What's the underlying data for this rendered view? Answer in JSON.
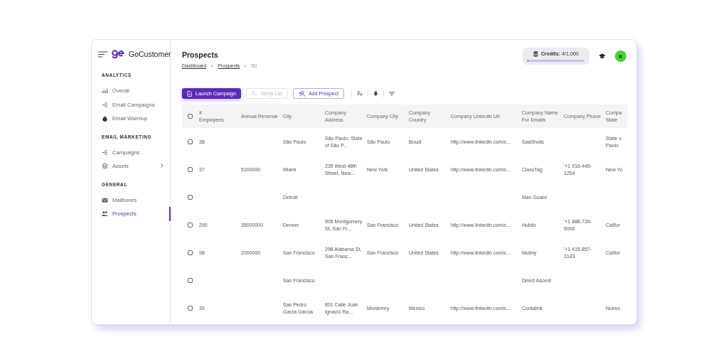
{
  "sidebar": {
    "logo": "GoCustomer",
    "sections": [
      {
        "title": "ANALYTICS",
        "items": [
          {
            "label": "Overall",
            "selected": false,
            "expandable": false
          },
          {
            "label": "Email Campaigns",
            "selected": false,
            "expandable": false
          },
          {
            "label": "Email Warmup",
            "selected": false,
            "expandable": false
          }
        ]
      },
      {
        "title": "EMAIL MARKETING",
        "items": [
          {
            "label": "Campaigns",
            "selected": false,
            "expandable": false
          },
          {
            "label": "Assets",
            "selected": false,
            "expandable": true
          }
        ]
      },
      {
        "title": "GENERAL",
        "items": [
          {
            "label": "Mailboxes",
            "selected": false,
            "expandable": false
          },
          {
            "label": "Prospects",
            "selected": true,
            "expandable": false
          }
        ]
      }
    ]
  },
  "header": {
    "title": "Prospects",
    "breadcrumb": [
      "Dashboard",
      "Prospects"
    ],
    "count": "50",
    "credits": {
      "label": "**Credits:** 4/1,000",
      "level": 0.004
    },
    "avatar": "K"
  },
  "toolbar": {
    "buttons": [
      {
        "label": "Launch Campaign",
        "kind": "primary",
        "disabled": false
      },
      {
        "label": "Verify List",
        "kind": "plain",
        "disabled": true
      },
      {
        "label": "Add Prospect",
        "kind": "outline",
        "disabled": false
      }
    ]
  },
  "table": {
    "all_checked": false,
    "columns": [
      "# Employees",
      "Annual Revenue",
      "City",
      "Company Address",
      "Company City",
      "Company Country",
      "Company Linkedin Url",
      "Company Name For Emails",
      "Company Phone",
      "Compa State"
    ],
    "rows": [
      {
        "checked": false,
        "cells": [
          "38",
          "",
          "São Paulo",
          "São Paulo, State of São P...",
          "São Paulo",
          "Brazil",
          "http://www.linkedin.com/c...",
          "SaaSholic",
          "",
          "State o Paulo"
        ]
      },
      {
        "checked": false,
        "cells": [
          "37",
          "5100000",
          "Miami",
          "235 West 48th Street, New...",
          "New York",
          "United States",
          "http://www.linkedin.com/c...",
          "ClassTag",
          "'+1 916-445-1254",
          "New Yo"
        ]
      },
      {
        "checked": false,
        "cells": [
          "",
          "",
          "Detroit",
          "",
          "",
          "",
          "",
          "Man Guard",
          "",
          ""
        ]
      },
      {
        "checked": false,
        "cells": [
          "290",
          "35000000",
          "Denver",
          "505 Montgomery St, San Fr...",
          "San Francisco",
          "United States",
          "http://www.linkedin.com/c...",
          "Hubilo",
          "'+1 888-726-5006",
          "Califor"
        ]
      },
      {
        "checked": false,
        "cells": [
          "98",
          "2000000",
          "San Francisco",
          "298 Alabama St, San Franc...",
          "San Francisco",
          "United States",
          "http://www.linkedin.com/c...",
          "Mutiny",
          "'+1 415-857-3143",
          "Califor"
        ]
      },
      {
        "checked": false,
        "cells": [
          "",
          "",
          "San Francisco",
          "",
          "",
          "",
          "",
          "Direct Ascent",
          "",
          ""
        ]
      },
      {
        "checked": false,
        "cells": [
          "35",
          "",
          "San Pedro Garza García",
          "801 Calle Juan Ignacio Ra...",
          "Monterrey",
          "Mexico",
          "http://www.linkedin.com/c...",
          "Contalink",
          "",
          "Nuevo"
        ]
      }
    ]
  }
}
